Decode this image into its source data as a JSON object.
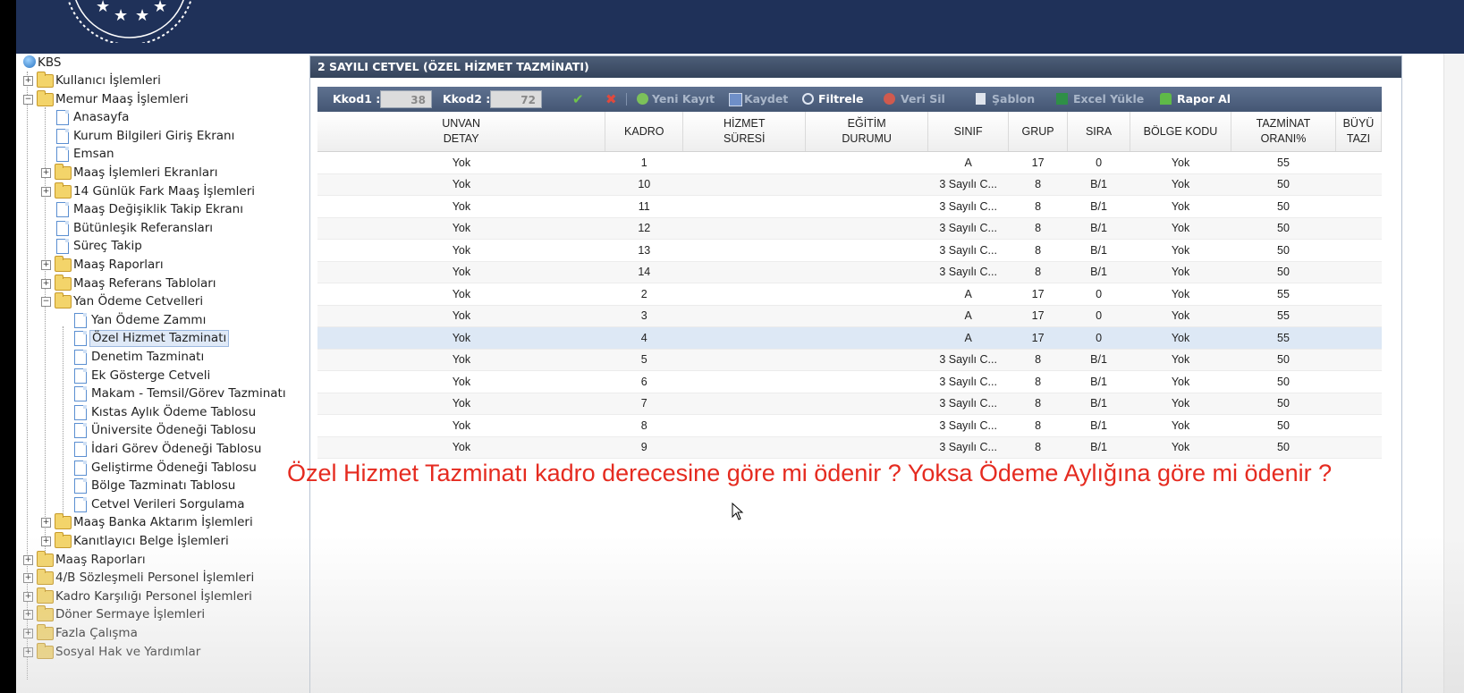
{
  "header": {
    "logo": "stars-emblem"
  },
  "tree": {
    "root": "KBS",
    "nodes": [
      {
        "label": "Kullanıcı İşlemleri",
        "type": "folder",
        "level": 1,
        "expander": "+"
      },
      {
        "label": "Memur Maaş İşlemleri",
        "type": "folder-open",
        "level": 1,
        "expander": "−"
      },
      {
        "label": "Anasayfa",
        "type": "page",
        "level": 2
      },
      {
        "label": "Kurum Bilgileri Giriş Ekranı",
        "type": "page",
        "level": 2
      },
      {
        "label": "Emsan",
        "type": "page",
        "level": 2
      },
      {
        "label": "Maaş İşlemleri Ekranları",
        "type": "folder",
        "level": 2,
        "expander": "+"
      },
      {
        "label": "14 Günlük Fark Maaş İşlemleri",
        "type": "folder",
        "level": 2,
        "expander": "+"
      },
      {
        "label": "Maaş Değişiklik Takip Ekranı",
        "type": "page",
        "level": 2
      },
      {
        "label": "Bütünleşik Referansları",
        "type": "page",
        "level": 2
      },
      {
        "label": "Süreç Takip",
        "type": "page",
        "level": 2
      },
      {
        "label": "Maaş Raporları",
        "type": "folder",
        "level": 2,
        "expander": "+"
      },
      {
        "label": "Maaş Referans Tabloları",
        "type": "folder",
        "level": 2,
        "expander": "+"
      },
      {
        "label": "Yan Ödeme Cetvelleri",
        "type": "folder-open",
        "level": 2,
        "expander": "−"
      },
      {
        "label": "Yan Ödeme Zammı",
        "type": "page",
        "level": 3
      },
      {
        "label": "Özel Hizmet Tazminatı",
        "type": "page",
        "level": 3,
        "selected": true
      },
      {
        "label": "Denetim Tazminatı",
        "type": "page",
        "level": 3
      },
      {
        "label": "Ek Gösterge Cetveli",
        "type": "page",
        "level": 3
      },
      {
        "label": "Makam - Temsil/Görev Tazminatı",
        "type": "page",
        "level": 3
      },
      {
        "label": "Kıstas Aylık Ödeme Tablosu",
        "type": "page",
        "level": 3
      },
      {
        "label": "Üniversite Ödeneği Tablosu",
        "type": "page",
        "level": 3
      },
      {
        "label": "İdari Görev Ödeneği Tablosu",
        "type": "page",
        "level": 3
      },
      {
        "label": "Geliştirme Ödeneği Tablosu",
        "type": "page",
        "level": 3
      },
      {
        "label": "Bölge Tazminatı Tablosu",
        "type": "page",
        "level": 3
      },
      {
        "label": "Cetvel Verileri Sorgulama",
        "type": "page",
        "level": 3
      },
      {
        "label": "Maaş Banka Aktarım İşlemleri",
        "type": "folder",
        "level": 2,
        "expander": "+"
      },
      {
        "label": "Kanıtlayıcı Belge İşlemleri",
        "type": "folder",
        "level": 2,
        "expander": "+"
      },
      {
        "label": "Maaş Raporları",
        "type": "folder",
        "level": 1,
        "expander": "+"
      },
      {
        "label": "4/B Sözleşmeli Personel İşlemleri",
        "type": "folder",
        "level": 1,
        "expander": "+"
      },
      {
        "label": "Kadro Karşılığı Personel İşlemleri",
        "type": "folder",
        "level": 1,
        "expander": "+"
      },
      {
        "label": "Döner Sermaye İşlemleri",
        "type": "folder",
        "level": 1,
        "expander": "+"
      },
      {
        "label": "Fazla Çalışma",
        "type": "folder",
        "level": 1,
        "expander": "+"
      },
      {
        "label": "Sosyal Hak ve Yardımlar",
        "type": "folder",
        "level": 1,
        "expander": "+"
      }
    ]
  },
  "panel": {
    "title": "2 SAYILI CETVEL (ÖZEL HİZMET TAZMİNATI)",
    "toolbar": {
      "kkod1_label": "Kkod1 :",
      "kkod1_value": "38",
      "kkod2_label": "Kkod2 :",
      "kkod2_value": "72",
      "new_record": "Yeni Kayıt",
      "save": "Kaydet",
      "filter": "Filtrele",
      "delete": "Veri Sil",
      "template": "Şablon",
      "excel_upload": "Excel Yükle",
      "report": "Rapor Al"
    },
    "columns": [
      "UNVAN\nDETAY",
      "KADRO",
      "HİZMET\nSÜRESİ",
      "EĞİTİM\nDURUMU",
      "SINIF",
      "GRUP",
      "SIRA",
      "BÖLGE KODU",
      "TAZMİNAT\nORANI%",
      "BÜYÜ\nTAZI"
    ],
    "rows": [
      [
        "Yok",
        "1",
        "",
        "",
        "A",
        "17",
        "0",
        "Yok",
        "55",
        ""
      ],
      [
        "Yok",
        "10",
        "",
        "",
        "3 Sayılı C...",
        "8",
        "B/1",
        "Yok",
        "50",
        ""
      ],
      [
        "Yok",
        "11",
        "",
        "",
        "3 Sayılı C...",
        "8",
        "B/1",
        "Yok",
        "50",
        ""
      ],
      [
        "Yok",
        "12",
        "",
        "",
        "3 Sayılı C...",
        "8",
        "B/1",
        "Yok",
        "50",
        ""
      ],
      [
        "Yok",
        "13",
        "",
        "",
        "3 Sayılı C...",
        "8",
        "B/1",
        "Yok",
        "50",
        ""
      ],
      [
        "Yok",
        "14",
        "",
        "",
        "3 Sayılı C...",
        "8",
        "B/1",
        "Yok",
        "50",
        ""
      ],
      [
        "Yok",
        "2",
        "",
        "",
        "A",
        "17",
        "0",
        "Yok",
        "55",
        ""
      ],
      [
        "Yok",
        "3",
        "",
        "",
        "A",
        "17",
        "0",
        "Yok",
        "55",
        ""
      ],
      [
        "Yok",
        "4",
        "",
        "",
        "A",
        "17",
        "0",
        "Yok",
        "55",
        ""
      ],
      [
        "Yok",
        "5",
        "",
        "",
        "3 Sayılı C...",
        "8",
        "B/1",
        "Yok",
        "50",
        ""
      ],
      [
        "Yok",
        "6",
        "",
        "",
        "3 Sayılı C...",
        "8",
        "B/1",
        "Yok",
        "50",
        ""
      ],
      [
        "Yok",
        "7",
        "",
        "",
        "3 Sayılı C...",
        "8",
        "B/1",
        "Yok",
        "50",
        ""
      ],
      [
        "Yok",
        "8",
        "",
        "",
        "3 Sayılı C...",
        "8",
        "B/1",
        "Yok",
        "50",
        ""
      ],
      [
        "Yok",
        "9",
        "",
        "",
        "3 Sayılı C...",
        "8",
        "B/1",
        "Yok",
        "50",
        ""
      ]
    ],
    "selected_row": 8
  },
  "overlay_question": "Özel Hizmet Tazminatı  kadro derecesine göre mi ödenir ? Yoksa Ödeme Aylığına göre mi ödenir ?",
  "colors": {
    "banner": "#1f3159",
    "question": "#e52b20",
    "panel_header": "#3c4b64",
    "selected_row": "#dde8f5"
  }
}
